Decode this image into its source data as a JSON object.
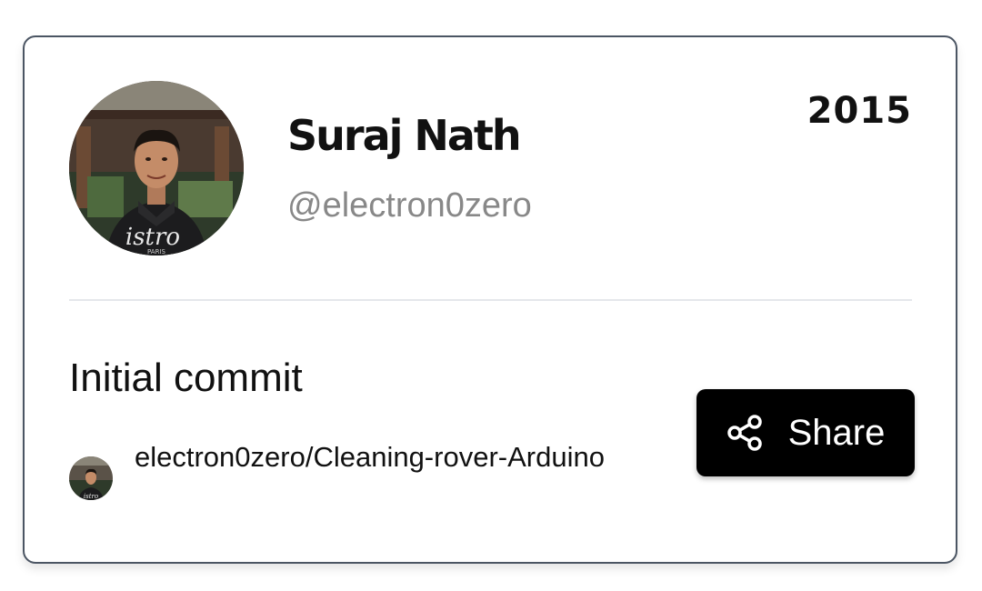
{
  "profile": {
    "name": "Suraj Nath",
    "handle": "@electron0zero",
    "year": "2015",
    "avatar_icon": "user-avatar-photo"
  },
  "commit": {
    "message": "Initial commit",
    "repo": "electron0zero/Cleaning-rover-Arduino"
  },
  "share": {
    "label": "Share",
    "icon": "share-icon"
  },
  "colors": {
    "button_bg": "#000000",
    "button_text": "#ffffff",
    "handle_text": "#888888",
    "card_border": "#4b5563"
  }
}
